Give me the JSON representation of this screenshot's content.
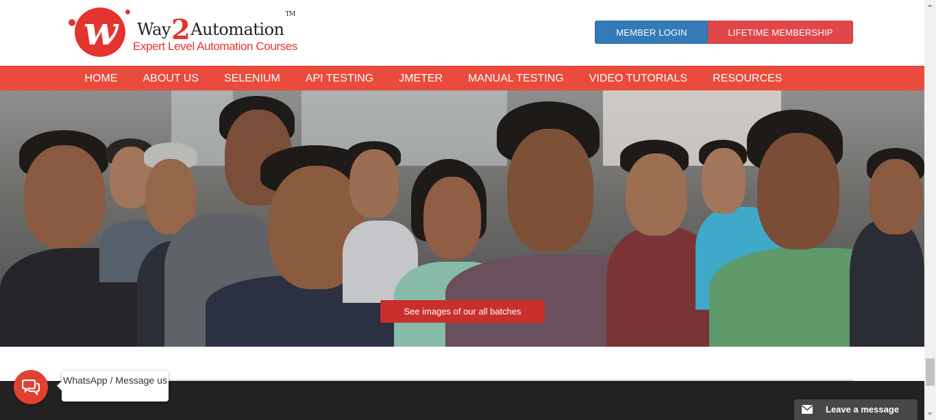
{
  "brand": {
    "logo_letter": "w",
    "name_part1": "Way",
    "name_two": "2",
    "name_part2": "Automation",
    "trademark": "TM",
    "tagline": "Expert Level Automation Courses"
  },
  "header": {
    "member_login": "MEMBER LOGIN",
    "lifetime_membership": "LIFETIME MEMBERSHIP"
  },
  "nav": {
    "items": [
      "HOME",
      "ABOUT US",
      "SELENIUM",
      "API TESTING",
      "JMETER",
      "MANUAL TESTING",
      "VIDEO TUTORIALS",
      "RESOURCES"
    ]
  },
  "hero": {
    "button_label": "See images of our all batches"
  },
  "chat": {
    "tooltip": "WhatsApp / Message us",
    "icon": "chat-bubbles-icon"
  },
  "leave_message": {
    "label": "Leave a message",
    "icon": "envelope-icon"
  },
  "colors": {
    "brand_red": "#e94b3c",
    "login_blue": "#337ab7",
    "lifetime_red": "#e1474a",
    "footer_dark": "#222222"
  }
}
